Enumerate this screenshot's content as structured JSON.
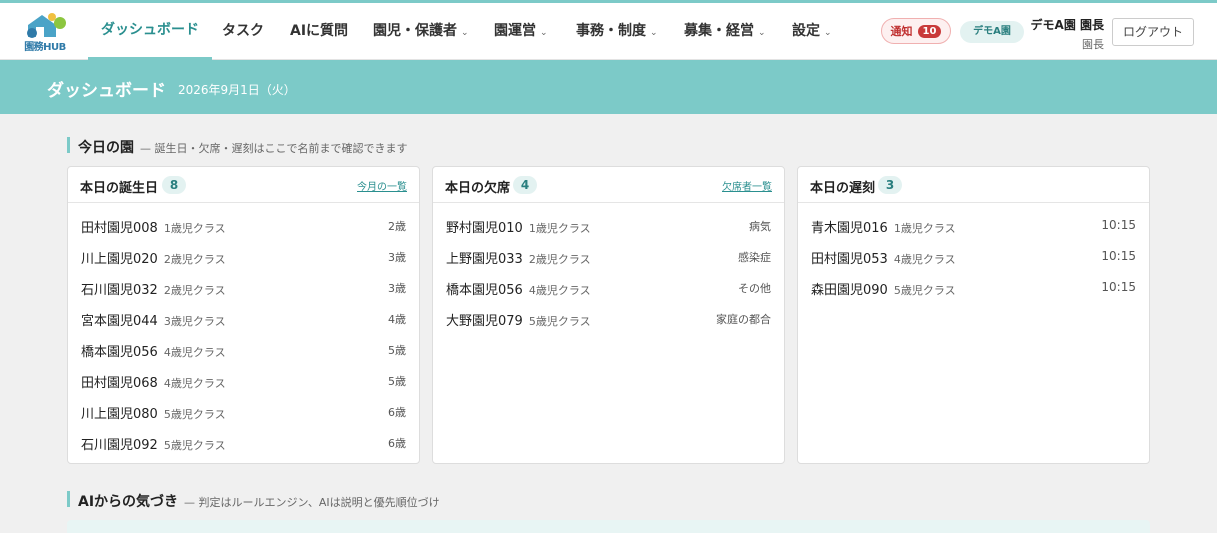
{
  "brand": {
    "logo_text": "園務HUB"
  },
  "nav": {
    "items": [
      {
        "label": "ダッシュボード",
        "has_menu": false
      },
      {
        "label": "タスク",
        "has_menu": false
      },
      {
        "label": "AIに質問",
        "has_menu": false
      },
      {
        "label": "園児・保護者",
        "has_menu": true
      },
      {
        "label": "園運営",
        "has_menu": true
      },
      {
        "label": "事務・制度",
        "has_menu": true
      },
      {
        "label": "募集・経営",
        "has_menu": true
      },
      {
        "label": "設定",
        "has_menu": true
      }
    ],
    "active_index": 0
  },
  "header": {
    "notification_label": "通知",
    "notification_count": "10",
    "demo_badge": "デモA園",
    "user_name": "デモA園 園長",
    "user_role": "園長",
    "logout_label": "ログアウト"
  },
  "banner": {
    "title": "ダッシュボード",
    "date": "2026年9月1日（火）"
  },
  "today_section": {
    "title": "今日の園",
    "subtitle": "— 誕生日・欠席・遅刻はここで名前まで確認できます"
  },
  "cards": [
    {
      "title": "本日の誕生日",
      "count": "8",
      "link": "今月の一覧",
      "rows": [
        {
          "name": "田村園児008",
          "class": "1歳児クラス",
          "value": "2歳"
        },
        {
          "name": "川上園児020",
          "class": "2歳児クラス",
          "value": "3歳"
        },
        {
          "name": "石川園児032",
          "class": "2歳児クラス",
          "value": "3歳"
        },
        {
          "name": "宮本園児044",
          "class": "3歳児クラス",
          "value": "4歳"
        },
        {
          "name": "橋本園児056",
          "class": "4歳児クラス",
          "value": "5歳"
        },
        {
          "name": "田村園児068",
          "class": "4歳児クラス",
          "value": "5歳"
        },
        {
          "name": "川上園児080",
          "class": "5歳児クラス",
          "value": "6歳"
        },
        {
          "name": "石川園児092",
          "class": "5歳児クラス",
          "value": "6歳"
        }
      ]
    },
    {
      "title": "本日の欠席",
      "count": "4",
      "link": "欠席者一覧",
      "rows": [
        {
          "name": "野村園児010",
          "class": "1歳児クラス",
          "value": "病気"
        },
        {
          "name": "上野園児033",
          "class": "2歳児クラス",
          "value": "感染症"
        },
        {
          "name": "橋本園児056",
          "class": "4歳児クラス",
          "value": "その他"
        },
        {
          "name": "大野園児079",
          "class": "5歳児クラス",
          "value": "家庭の都合"
        }
      ]
    },
    {
      "title": "本日の遅刻",
      "count": "3",
      "link": "",
      "rows": [
        {
          "name": "青木園児016",
          "class": "1歳児クラス",
          "value": "10:15"
        },
        {
          "name": "田村園児053",
          "class": "4歳児クラス",
          "value": "10:15"
        },
        {
          "name": "森田園児090",
          "class": "5歳児クラス",
          "value": "10:15"
        }
      ]
    }
  ],
  "ai_section": {
    "title": "AIからの気づき",
    "subtitle": "— 判定はルールエンジン、AIは説明と優先順位づけ"
  }
}
